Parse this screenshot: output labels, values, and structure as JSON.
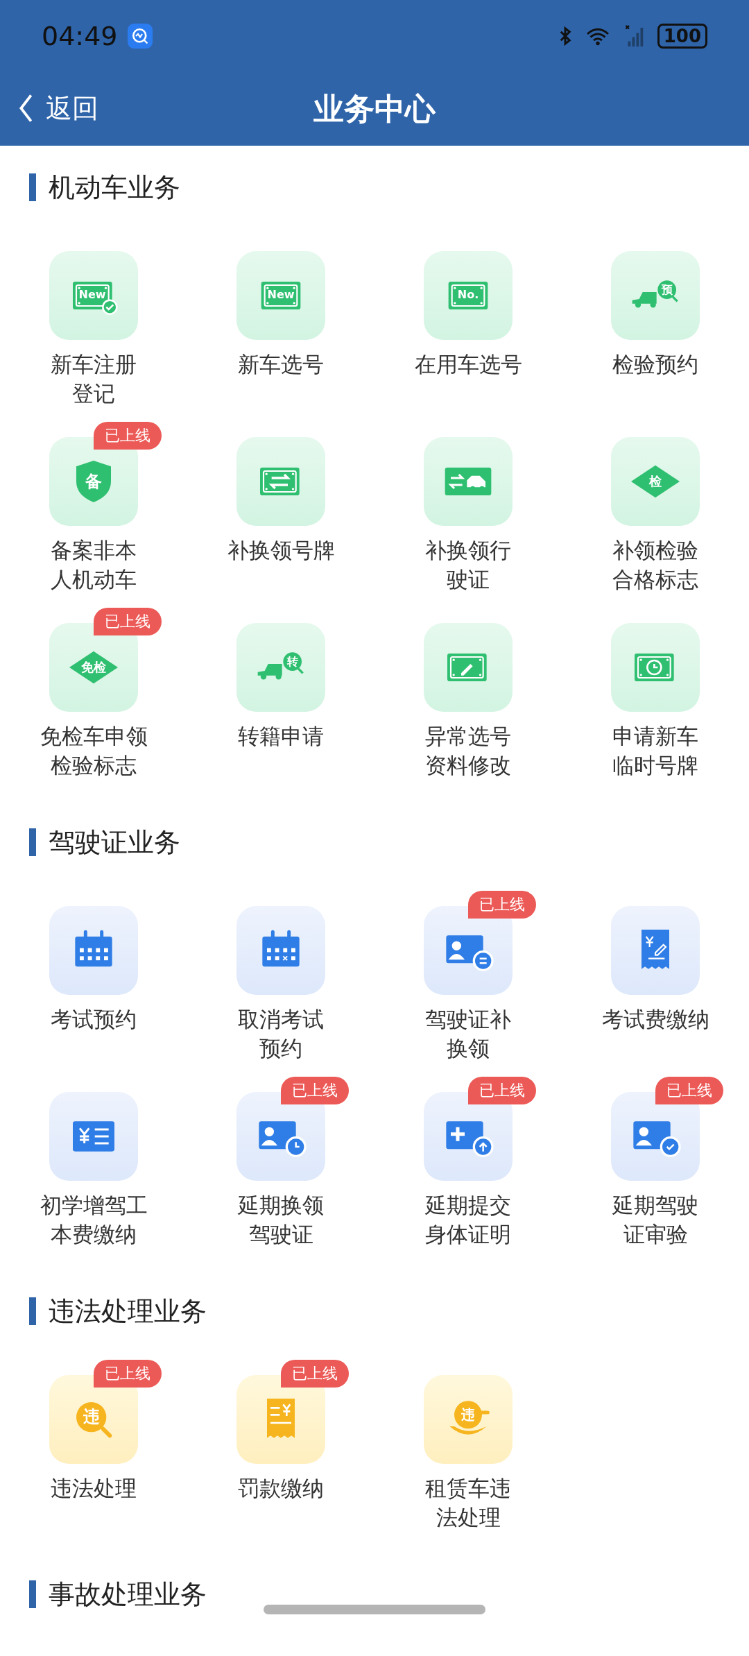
{
  "status_bar": {
    "time": "04:49",
    "battery": "100"
  },
  "header": {
    "back": "返回",
    "title": "业务中心"
  },
  "sections": [
    {
      "title": "机动车业务",
      "items": [
        {
          "lines": [
            "新车注册",
            "登记"
          ],
          "glyph": "New"
        },
        {
          "lines": [
            "新车选号"
          ],
          "glyph": "New"
        },
        {
          "lines": [
            "在用车选号"
          ],
          "glyph": "No."
        },
        {
          "lines": [
            "检验预约"
          ],
          "glyph": "预"
        },
        {
          "lines": [
            "备案非本",
            "人机动车"
          ],
          "glyph": "备",
          "badge": "已上线"
        },
        {
          "lines": [
            "补换领号牌"
          ]
        },
        {
          "lines": [
            "补换领行",
            "驶证"
          ]
        },
        {
          "lines": [
            "补领检验",
            "合格标志"
          ],
          "glyph": "检"
        },
        {
          "lines": [
            "免检车申领",
            "检验标志"
          ],
          "glyph": "免检",
          "badge": "已上线"
        },
        {
          "lines": [
            "转籍申请"
          ],
          "glyph": "转"
        },
        {
          "lines": [
            "异常选号",
            "资料修改"
          ]
        },
        {
          "lines": [
            "申请新车",
            "临时号牌"
          ]
        }
      ]
    },
    {
      "title": "驾驶证业务",
      "items": [
        {
          "lines": [
            "考试预约"
          ]
        },
        {
          "lines": [
            "取消考试",
            "预约"
          ]
        },
        {
          "lines": [
            "驾驶证补",
            "换领"
          ],
          "badge": "已上线"
        },
        {
          "lines": [
            "考试费缴纳"
          ]
        },
        {
          "lines": [
            "初学增驾工",
            "本费缴纳"
          ]
        },
        {
          "lines": [
            "延期换领",
            "驾驶证"
          ],
          "badge": "已上线"
        },
        {
          "lines": [
            "延期提交",
            "身体证明"
          ],
          "badge": "已上线"
        },
        {
          "lines": [
            "延期驾驶",
            "证审验"
          ],
          "badge": "已上线"
        }
      ]
    },
    {
      "title": "违法处理业务",
      "items": [
        {
          "lines": [
            "违法处理"
          ],
          "glyph": "违",
          "badge": "已上线"
        },
        {
          "lines": [
            "罚款缴纳"
          ],
          "badge": "已上线"
        },
        {
          "lines": [
            "租赁车违",
            "法处理"
          ],
          "glyph": "违"
        }
      ]
    },
    {
      "title": "事故处理业务"
    }
  ]
}
